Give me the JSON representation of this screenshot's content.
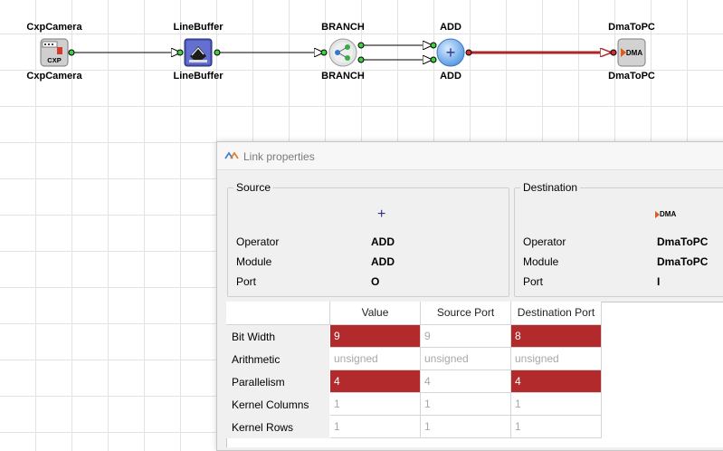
{
  "operators": [
    {
      "title": "CxpCamera",
      "sub": "CxpCamera",
      "icon": "cxp-camera-icon"
    },
    {
      "title": "LineBuffer",
      "sub": "LineBuffer",
      "icon": "line-buffer-icon"
    },
    {
      "title": "BRANCH",
      "sub": "BRANCH",
      "icon": "branch-icon"
    },
    {
      "title": "ADD",
      "sub": "ADD",
      "icon": "add-icon"
    },
    {
      "title": "DmaToPC",
      "sub": "DmaToPC",
      "icon": "dma-icon"
    }
  ],
  "icons": {
    "cxp_badge": "CXP",
    "dma_badge": "DMA",
    "add_glyph": "+"
  },
  "dialog": {
    "title": "Link properties",
    "source": {
      "group_label": "Source",
      "glyph": "+",
      "operator_label": "Operator",
      "operator_value": "ADD",
      "module_label": "Module",
      "module_value": "ADD",
      "port_label": "Port",
      "port_value": "O"
    },
    "destination": {
      "group_label": "Destination",
      "glyph": "DMA",
      "operator_label": "Operator",
      "operator_value": "DmaToPC",
      "module_label": "Module",
      "module_value": "DmaToPC",
      "port_label": "Port",
      "port_value": "I"
    },
    "table": {
      "columns": [
        "Value",
        "Source Port",
        "Destination Port"
      ],
      "rows": [
        {
          "label": "Bit Width",
          "cells": [
            "9",
            "9",
            "8"
          ]
        },
        {
          "label": "Arithmetic",
          "cells": [
            "unsigned",
            "unsigned",
            "unsigned"
          ]
        },
        {
          "label": "Parallelism",
          "cells": [
            "4",
            "4",
            "4"
          ]
        },
        {
          "label": "Kernel Columns",
          "cells": [
            "1",
            "1",
            "1"
          ]
        },
        {
          "label": "Kernel Rows",
          "cells": [
            "1",
            "1",
            "1"
          ]
        }
      ]
    }
  },
  "colors": {
    "mismatch": "#b22a2c",
    "link_selected": "#c0292b",
    "add_blue": "#5aa0e8"
  }
}
